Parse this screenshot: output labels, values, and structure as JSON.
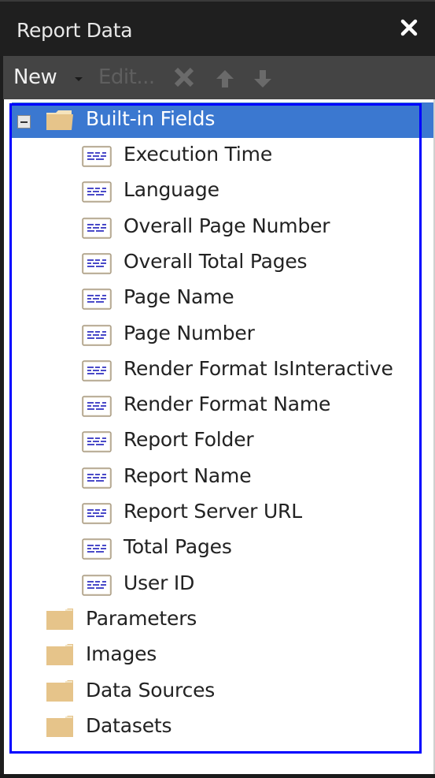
{
  "window": {
    "title": "Report Data",
    "close_icon": "close-icon"
  },
  "toolbar": {
    "new_label": "New",
    "edit_label": "Edit...",
    "delete_icon": "delete-x-icon",
    "move_up_icon": "arrow-up-icon",
    "move_down_icon": "arrow-down-icon"
  },
  "tree": {
    "root": {
      "label": "Built-in Fields",
      "expanded": true,
      "selected": true
    },
    "built_in_fields": [
      "Execution Time",
      "Language",
      "Overall Page Number",
      "Overall Total Pages",
      "Page Name",
      "Page Number",
      "Render Format IsInteractive",
      "Render Format Name",
      "Report Folder",
      "Report Name",
      "Report Server URL",
      "Total Pages",
      "User ID"
    ],
    "folders": [
      "Parameters",
      "Images",
      "Data Sources",
      "Datasets"
    ]
  },
  "colors": {
    "selection": "#3b78d0",
    "outline": "#0000ff",
    "folder": "#e6c48a",
    "titlebar": "#1f1f1f",
    "toolbar": "#444444"
  }
}
